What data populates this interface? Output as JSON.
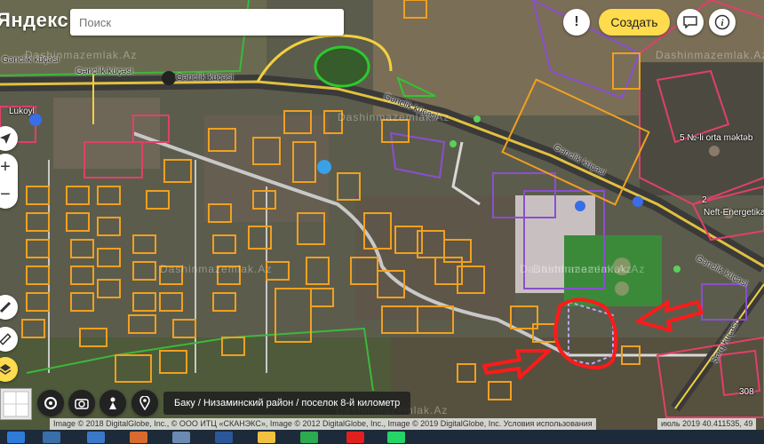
{
  "app": {
    "logo": "Яндекс"
  },
  "search": {
    "placeholder": "Поиск"
  },
  "toolbar": {
    "alert_label": "!",
    "create_label": "Создать",
    "info_label": "i"
  },
  "zoom": {
    "in": "+",
    "out": "−"
  },
  "streets": {
    "top_left": "Gənclik küçəsi",
    "top_center": "Gənclik küçəsi",
    "middle": "Gənclik küçəsi",
    "right": "Gənclik küçəsi",
    "far_right": "Gənclik küçəsi",
    "sharq": "Şərq küçəsi"
  },
  "places": {
    "lukoyl": "Lukoyl",
    "school": "5 №-li orta məktəb",
    "neft": "Neft-Energetika K",
    "num2": "2",
    "num308": "308"
  },
  "watermarks": [
    "Dashinmazemlak.Az",
    "Dashinmazemlak.Az",
    "Dashinmazemlak.Az",
    "Dashinmazemlak.Az",
    "Dashinmazemlak.Az",
    "Dashinmazemlak.Az",
    "Dashinmazemlak.Az"
  ],
  "address": "Баку / Низаминский район / поселок 8-й километр",
  "copyright": "Image © 2018 DigitalGlobe, Inc., © ООО ИТЦ «СКАНЭКС», Image © 2012 DigitalGlobe, Inc., Image © 2019 DigitalGlobe, Inc. Условия использования",
  "scale": "июль 2019  40.411535, 49",
  "colors": {
    "accent": "#ffdb4d",
    "parcel_orange": "#f0a020",
    "parcel_purple": "#8a4fd0",
    "parcel_pink": "#e0406a",
    "highlight_red": "#ff1a1a",
    "road_yellow": "#f4d03f"
  },
  "icons": {
    "alert": "exclamation-icon",
    "messages": "message-icon",
    "info": "info-icon",
    "locate": "locate-arrow-icon",
    "ruler": "ruler-icon",
    "layers": "layers-icon",
    "routes": "route-icon",
    "pin": "pin-icon",
    "camera": "camera-icon",
    "panorama": "panorama-icon"
  }
}
